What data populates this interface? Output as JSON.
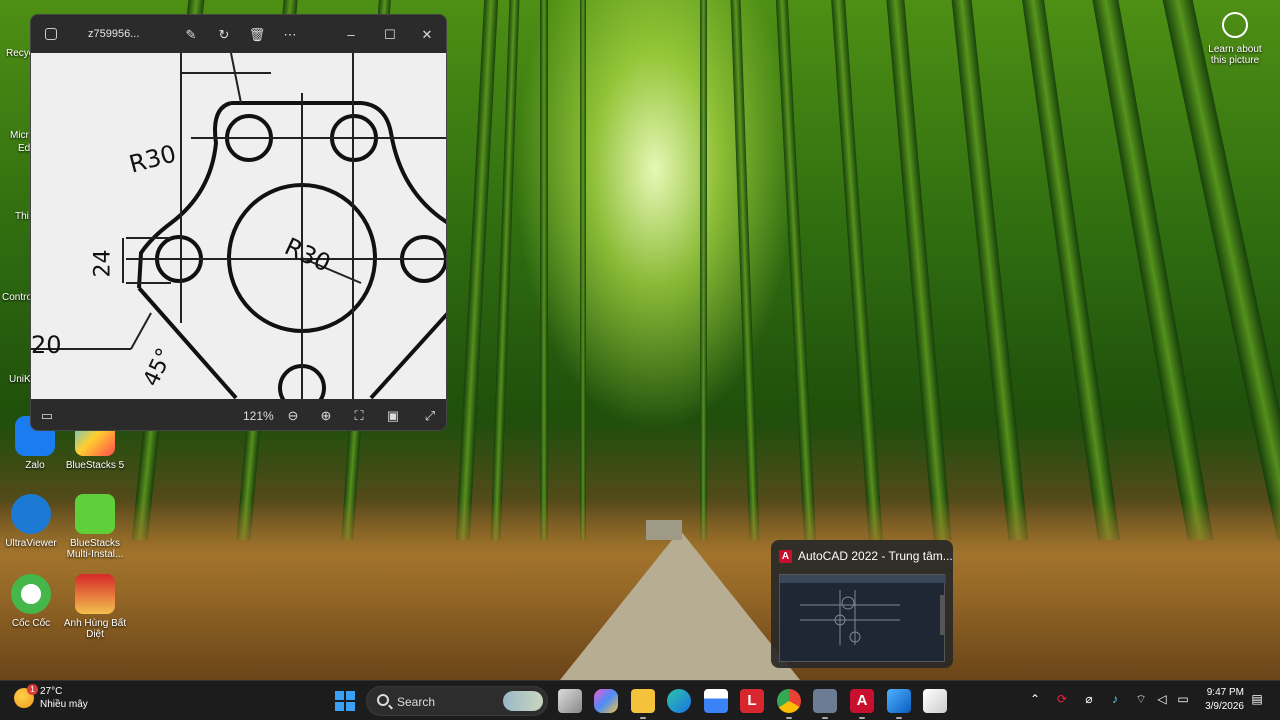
{
  "desktop": {
    "icons": [
      {
        "label": "Zalo"
      },
      {
        "label": "BlueStacks 5"
      },
      {
        "label": "UltraViewer"
      },
      {
        "label": "BlueStacks Multi-Instal..."
      },
      {
        "label": "Cốc Cốc"
      },
      {
        "label": "Anh Hùng Bất Diệt"
      }
    ],
    "partial_labels": [
      "Recyc",
      "Micr",
      "Ed",
      "Thi",
      "Contro",
      "UniK"
    ],
    "learn_about": "Learn about this picture"
  },
  "photo_window": {
    "filename": "z759956...",
    "zoom": "121%",
    "drawing_labels": {
      "r_top": "R30",
      "r_center": "R30",
      "dim_24": "24",
      "dim_20": "20",
      "dim_45": "45°"
    }
  },
  "autocad_preview": {
    "title": "AutoCAD 2022 - Trung tâm..."
  },
  "taskbar": {
    "weather_temp": "27°C",
    "weather_desc": "Nhiều mây",
    "weather_badge": "1",
    "search_placeholder": "Search",
    "time": "9:47 PM",
    "date": "3/9/2026"
  }
}
